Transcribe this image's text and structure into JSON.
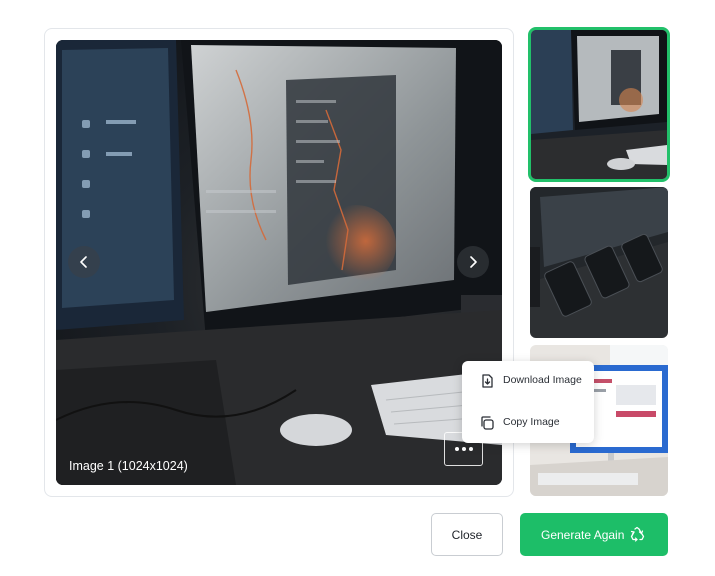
{
  "viewer": {
    "caption": "Image 1 (1024x1024)",
    "prev_icon": "chevron-left-icon",
    "next_icon": "chevron-right-icon",
    "more_icon": "more-horizontal-icon"
  },
  "thumbnails": [
    {
      "label": "thumbnail-1",
      "selected": true
    },
    {
      "label": "thumbnail-2",
      "selected": false
    },
    {
      "label": "thumbnail-3",
      "selected": false
    }
  ],
  "context_menu": {
    "items": [
      {
        "label": "Download Image",
        "icon": "download-file-icon"
      },
      {
        "label": "Copy Image",
        "icon": "copy-icon"
      }
    ]
  },
  "footer": {
    "close_label": "Close",
    "generate_label": "Generate Again",
    "generate_icon": "recycle-icon"
  },
  "colors": {
    "accent": "#1dbe68",
    "selected_border": "#22c06a"
  }
}
